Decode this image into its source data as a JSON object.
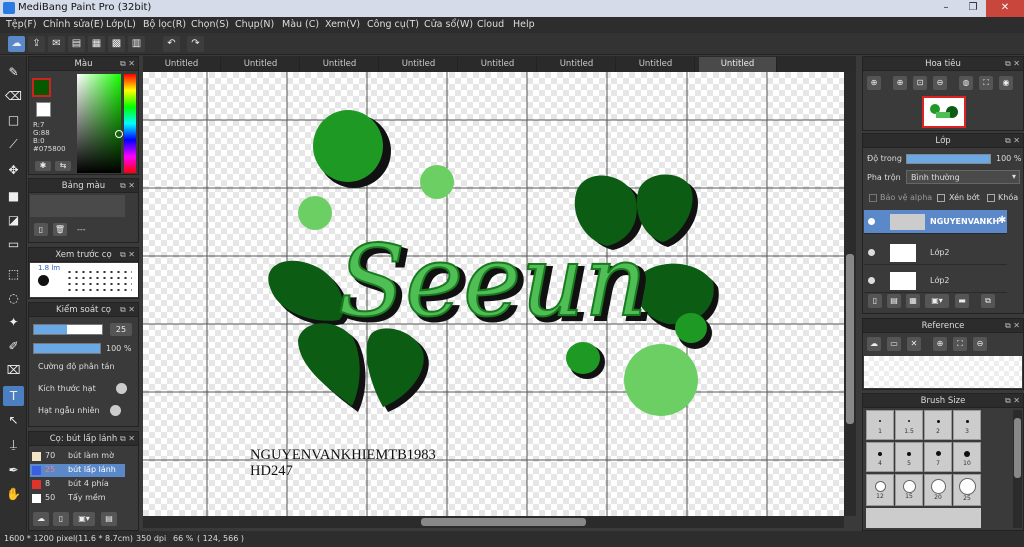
{
  "app": {
    "title": "MediBang Paint Pro (32bit)",
    "win_min": "–",
    "win_max": "❐",
    "win_close": "✕"
  },
  "menu": [
    "Tệp(F)",
    "Chỉnh sửa(E)",
    "Lớp(L)",
    "Bộ lọc(R)",
    "Chọn(S)",
    "Chụp(N)",
    "Màu (C)",
    "Xem(V)",
    "Công cụ(T)",
    "Cửa sổ(W)",
    "Cloud",
    "Help"
  ],
  "tabs": [
    "Untitled",
    "Untitled",
    "Untitled",
    "Untitled",
    "Untitled",
    "Untitled",
    "Untitled",
    "Untitled"
  ],
  "color_panel": {
    "title": "Màu",
    "r": "R:7",
    "g": "G:88",
    "b": "B:0",
    "hex": "#075800",
    "fg": "#075800"
  },
  "palette_panel": {
    "title": "Bảng màu",
    "dash": "---"
  },
  "brush_preview": {
    "title": "Xem trước cọ",
    "size": "1.8 lm"
  },
  "brush_control": {
    "title": "Kiểm soát cọ",
    "size": "25",
    "opacity": "100 %",
    "row1": "Cường độ phân tán",
    "row2": "Kích thước hạt",
    "row3": "Hạt ngẫu nhiên"
  },
  "brushes": {
    "title": "Cọ: bút lấp lánh",
    "items": [
      {
        "size": "70",
        "name": "bút làm mờ",
        "color": "#f3e6c8"
      },
      {
        "size": "25",
        "name": "bút lấp lánh",
        "color": "#3a5fe0"
      },
      {
        "size": "8",
        "name": "bút 4 phía",
        "color": "#e0332b"
      },
      {
        "size": "50",
        "name": "Tẩy mềm",
        "color": "#ffffff"
      }
    ]
  },
  "navigator": {
    "title": "Hoa tiêu"
  },
  "layer_panel": {
    "title": "Lớp",
    "opacity_label": "Độ trong",
    "opacity_value": "100 %",
    "opacity": 1.0,
    "blend_label": "Pha trộn",
    "blend_value": "Bình thường",
    "protect_alpha": "Bảo vệ alpha",
    "clip": "Xén bớt",
    "lock": "Khóa",
    "layers": [
      {
        "name": "NGUYENVANKH"
      },
      {
        "name": "Lớp2"
      },
      {
        "name": "Lớp2"
      }
    ]
  },
  "reference_panel": {
    "title": "Reference"
  },
  "brush_size_panel": {
    "title": "Brush Size",
    "sizes": [
      "1",
      "1.5",
      "2",
      "3",
      "4",
      "5",
      "7",
      "10",
      "12",
      "15",
      "20",
      "25"
    ]
  },
  "canvas_text": {
    "line1": "NGUYENVANKHIEMTB1983",
    "line2": "HD247",
    "word": "Seeun"
  },
  "colors": {
    "dark_green": "#0d5c14",
    "mid_green": "#1e9a24",
    "light_green": "#6ccf64",
    "accent": "#5a88c8"
  },
  "status": {
    "dims": "1600 * 1200 pixel",
    "cm": "(11.6 * 8.7cm)",
    "dpi": "350 dpi",
    "zoom": "66 %",
    "coord": "( 124, 566 )"
  }
}
